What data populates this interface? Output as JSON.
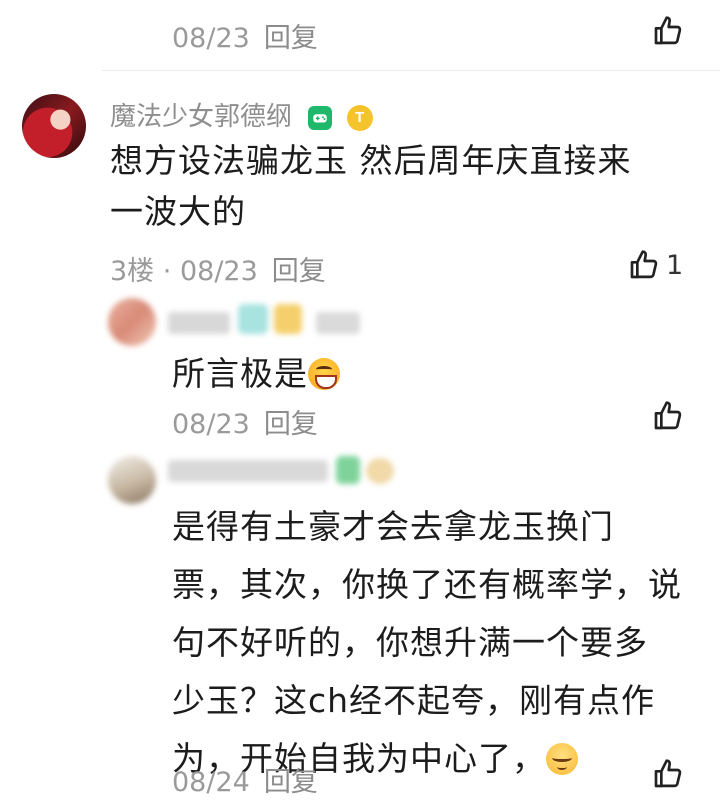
{
  "top_comment": {
    "date": "08/23",
    "reply_label": "回复"
  },
  "main_comment": {
    "username": "魔法少女郭德纲",
    "text_line1": "想方设法骗龙玉 然后周年庆直接来",
    "text_line2": "一波大的",
    "floor": "3楼",
    "separator": "·",
    "date": "08/23",
    "reply_label": "回复",
    "like_count": "1",
    "badge_coin_letter": "T"
  },
  "reply1": {
    "text": "所言极是",
    "date": "08/23",
    "reply_label": "回复"
  },
  "reply2": {
    "lines": [
      "是得有土豪才会去拿龙玉换门",
      "票，其次，你换了还有概率学，说",
      "句不好听的，你想升满一个要多",
      "少玉？这ch经不起夸，刚有点作",
      "为，开始自我为中心了，"
    ],
    "date": "08/24",
    "reply_label": "回复"
  },
  "colors": {
    "meta_text": "#9a9a9a",
    "body_text": "#1c1c1c",
    "game_badge": "#1fb86a",
    "coin_badge": "#f5c42c"
  },
  "icons": {
    "like": "thumbs-up-icon",
    "game_badge": "gamepad-icon",
    "coin_badge": "coin-icon"
  }
}
